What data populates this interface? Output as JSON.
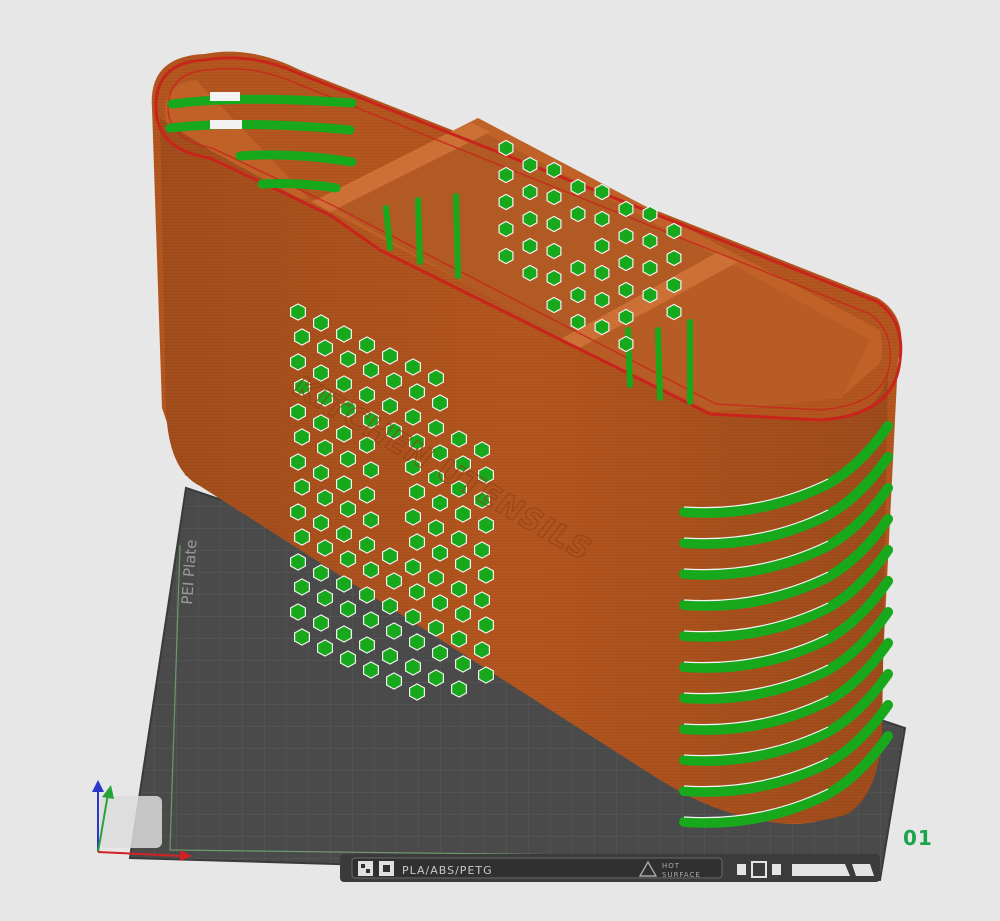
{
  "plate": {
    "label": "PEI Plate",
    "filament": "PLA/ABS/PETG",
    "hot_surface": [
      "HOT",
      "SURFACE"
    ],
    "index": "01",
    "index_color": "#19a34a"
  },
  "model": {
    "embossed_text": "KITCHEN UTENSILS",
    "body_color": "#b4561f",
    "infill_color": "#17a81c",
    "outline_color": "#c8241b"
  },
  "icons": {
    "axes": "xyz-axes-icon",
    "plate_logo": "build-plate-logo-icon",
    "warning": "hot-surface-warning-icon",
    "plate_marks": "plate-orientation-icons"
  }
}
